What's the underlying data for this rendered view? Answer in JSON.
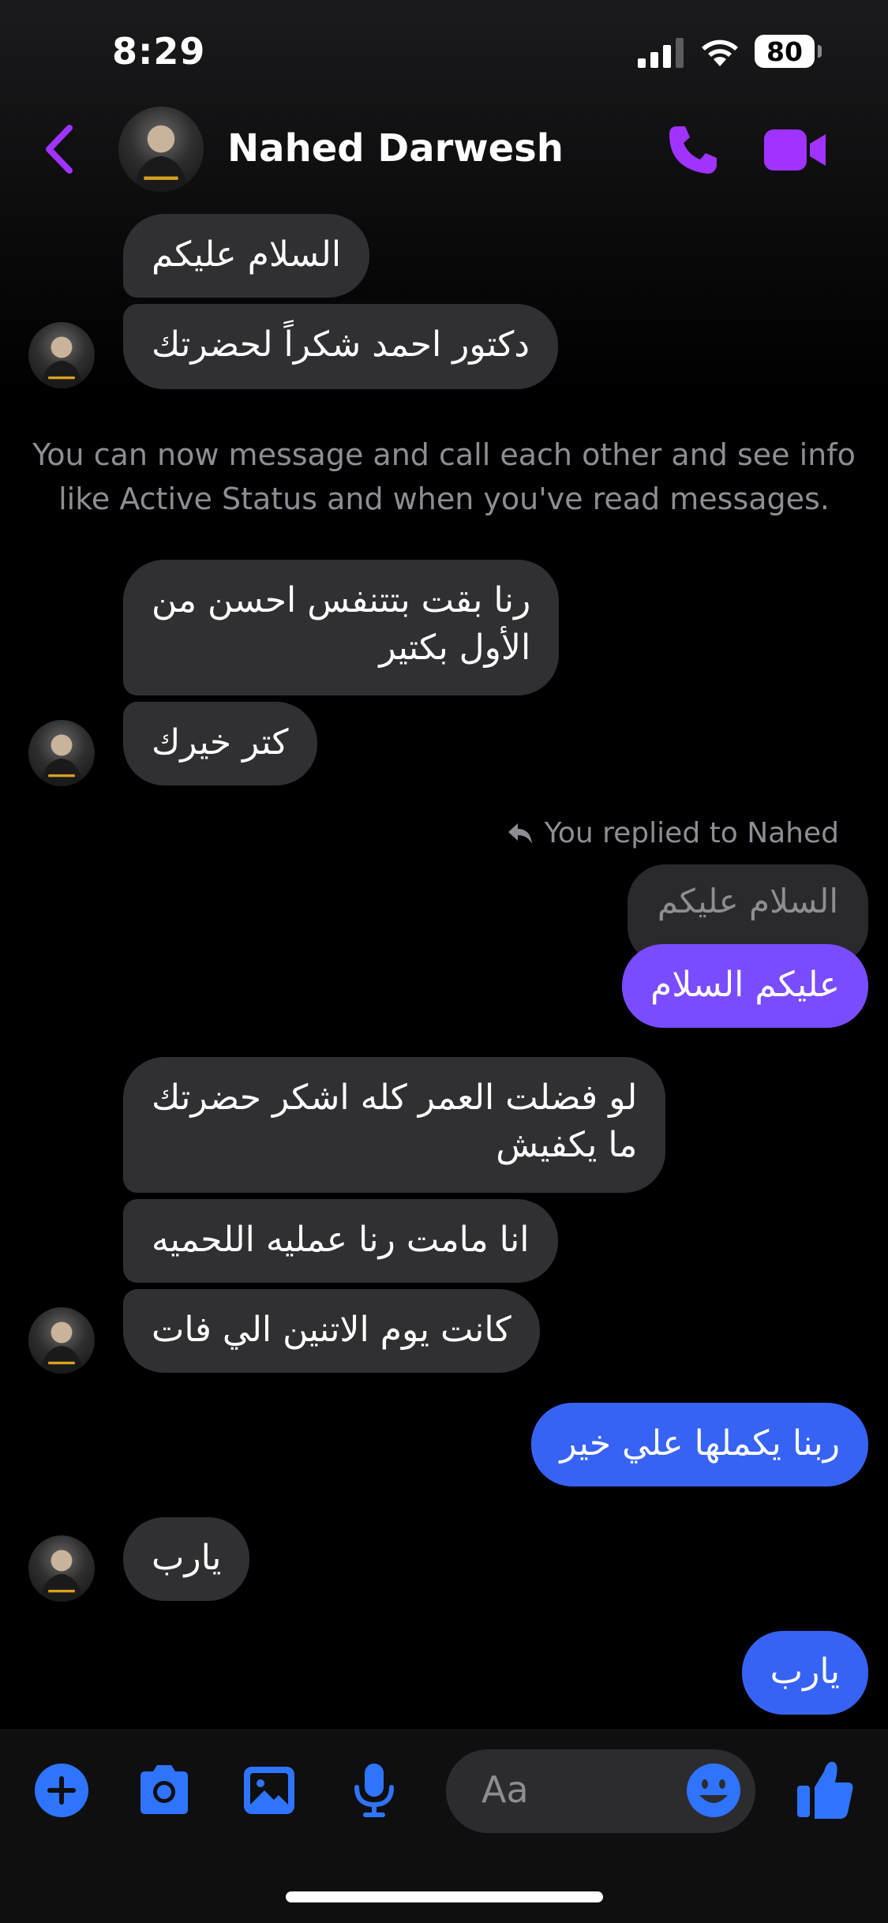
{
  "status_bar": {
    "time": "8:29",
    "battery": "80"
  },
  "header": {
    "contact_name": "Nahed Darwesh",
    "accent_color": "#a033ff"
  },
  "messages": {
    "m1": "السلام عليكم",
    "m2": "دكتور احمد شكراً لحضرتك",
    "system_note": "You can now message and call each other and see info like Active Status and when you've read messages.",
    "m3": "رنا بقت بتتنفس احسن من\nالأول بكتير",
    "m4": "كتر خيرك",
    "reply_label": "You replied to Nahed",
    "reply_quote": "السلام عليكم",
    "m5_out": "عليكم السلام",
    "m6": "لو فضلت العمر كله اشكر حضرتك\nما يكفيش",
    "m7": "انا مامت رنا عمليه اللحميه",
    "m8": "كانت يوم الاتنين الي فات",
    "m9_out": "ربنا يكملها علي خير",
    "m10": "يارب",
    "m11_out": "يارب"
  },
  "composer": {
    "placeholder": "Aa",
    "tool_color": "#2f74ff",
    "icons": [
      "plus-icon",
      "camera-icon",
      "image-icon",
      "microphone-icon",
      "emoji-icon",
      "thumbs-up-icon"
    ]
  },
  "colors": {
    "incoming_bubble": "#303033",
    "outgoing_bubble_top": "#7a4cff",
    "outgoing_bubble": "#3763f4",
    "secondary_text": "#8d8d92"
  }
}
